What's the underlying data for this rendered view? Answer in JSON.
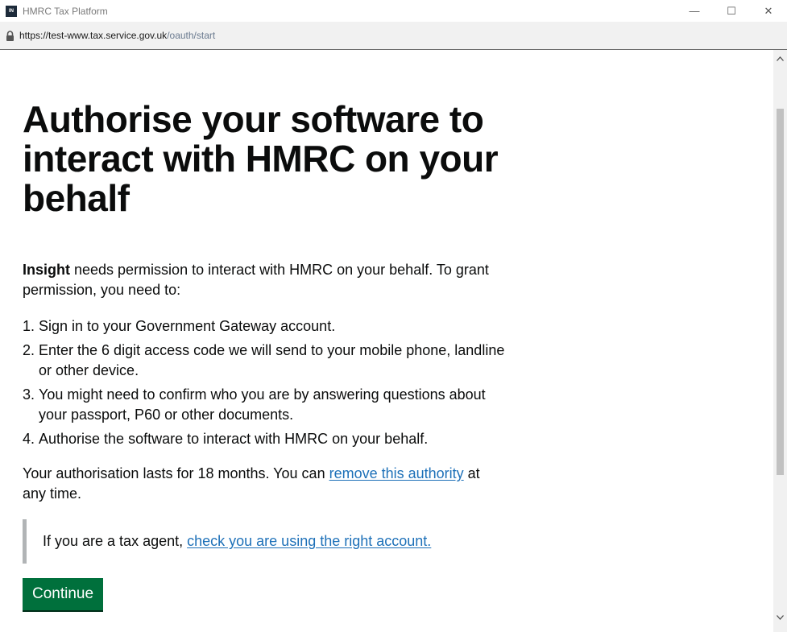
{
  "window": {
    "title": "HMRC Tax Platform",
    "app_icon_text": "IN",
    "minimize_glyph": "—",
    "maximize_glyph": "☐",
    "close_glyph": "✕"
  },
  "address": {
    "host": "https://test-www.tax.service.gov.uk",
    "path": "/oauth/start"
  },
  "page": {
    "heading": "Authorise your software to interact with HMRC on your behalf",
    "intro_bold": "Insight",
    "intro_rest": " needs permission to interact with HMRC on your behalf. To grant permission, you need to:",
    "steps": [
      {
        "num": "1.",
        "text": "Sign in to your Government Gateway account."
      },
      {
        "num": "2.",
        "text": "Enter the 6 digit access code we will send to your mobile phone, landline or other device."
      },
      {
        "num": "3.",
        "text": "You might need to confirm who you are by answering questions about your passport, P60 or other documents."
      },
      {
        "num": "4.",
        "text": "Authorise the software to interact with HMRC on your behalf."
      }
    ],
    "lasts_prefix": "Your authorisation lasts for 18 months. You can ",
    "lasts_link": "remove this authority",
    "lasts_suffix": " at any time.",
    "inset_prefix": "If you are a tax agent, ",
    "inset_link": "check you are using the right account.",
    "continue_label": "Continue"
  },
  "colors": {
    "link": "#1d70b8",
    "button": "#00703c",
    "inset_border": "#b1b4b6"
  }
}
